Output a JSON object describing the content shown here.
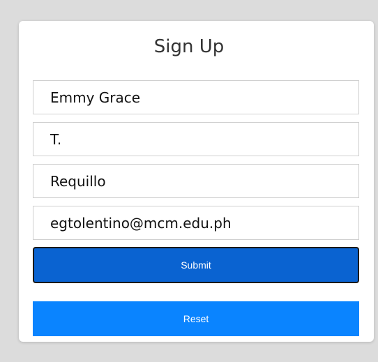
{
  "form": {
    "title": "Sign Up",
    "fields": [
      {
        "value": "Emmy Grace"
      },
      {
        "value": "T."
      },
      {
        "value": "Requillo"
      },
      {
        "value": "egtolentino@mcm.edu.ph"
      }
    ],
    "submit_label": "Submit",
    "reset_label": "Reset"
  },
  "colors": {
    "page_background": "#dcdcdc",
    "card_background": "#ffffff",
    "submit_button": "#0a63d1",
    "reset_button": "#0a84ff"
  }
}
